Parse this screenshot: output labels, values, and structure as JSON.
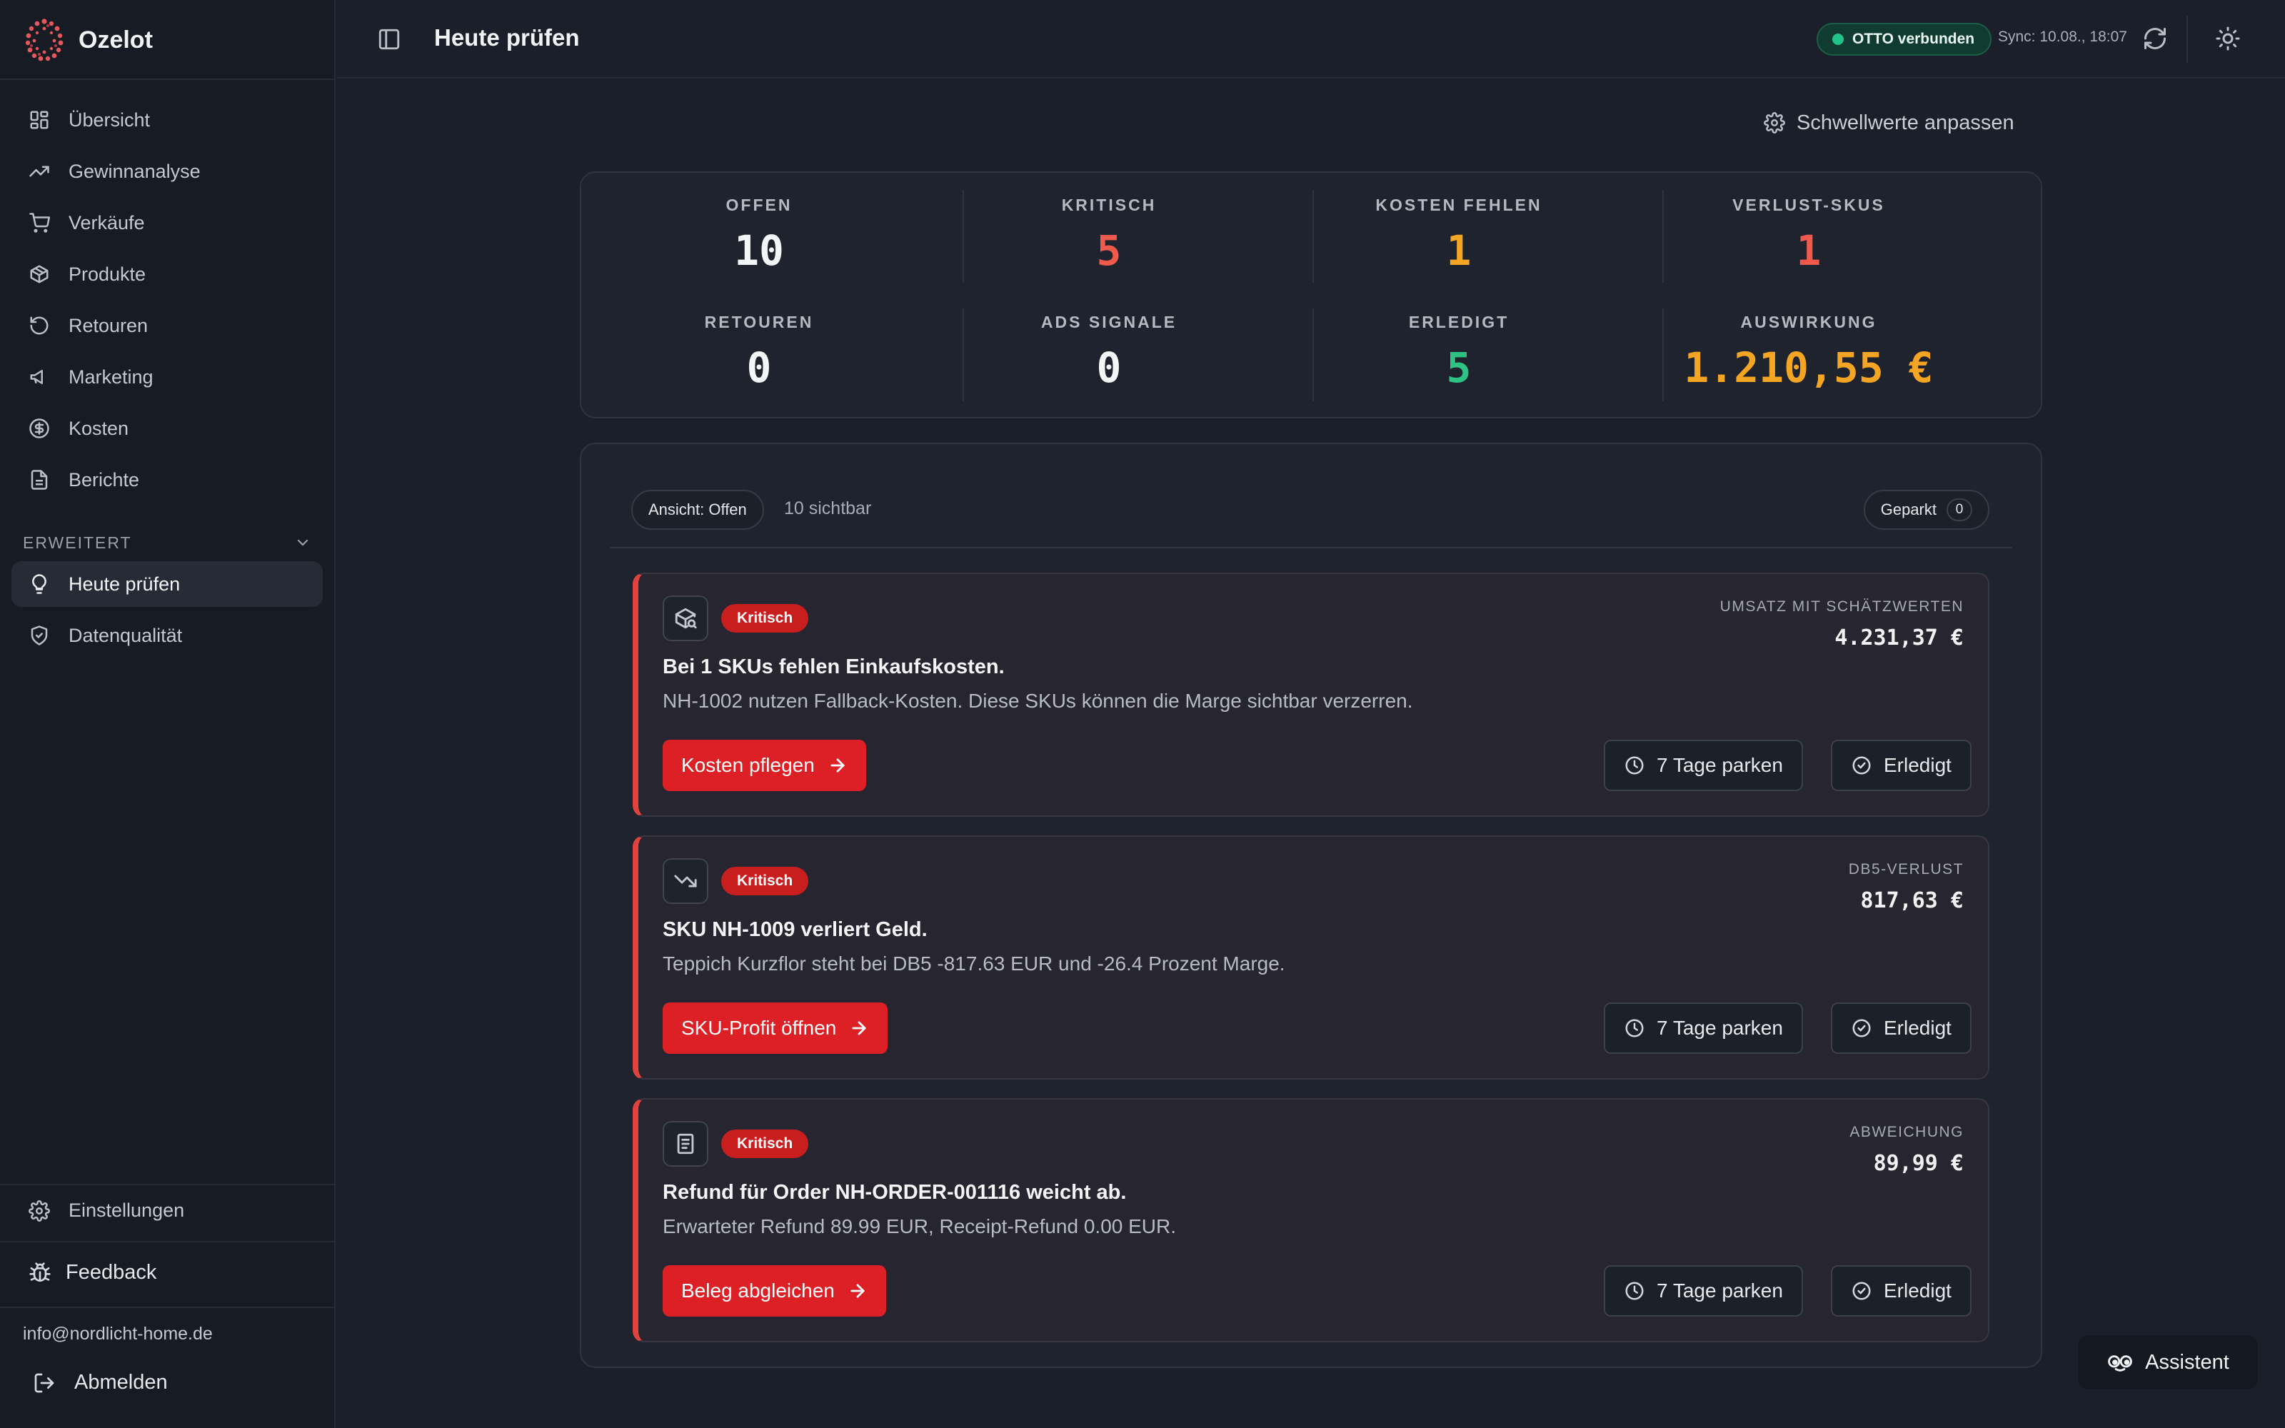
{
  "app": {
    "name": "Ozelot"
  },
  "sidebar": {
    "items": [
      {
        "label": "Übersicht",
        "icon": "dashboard-icon"
      },
      {
        "label": "Gewinnanalyse",
        "icon": "trending-up-icon"
      },
      {
        "label": "Verkäufe",
        "icon": "cart-icon"
      },
      {
        "label": "Produkte",
        "icon": "package-icon"
      },
      {
        "label": "Retouren",
        "icon": "undo-icon"
      },
      {
        "label": "Marketing",
        "icon": "megaphone-icon"
      },
      {
        "label": "Kosten",
        "icon": "dollar-circle-icon"
      },
      {
        "label": "Berichte",
        "icon": "file-text-icon"
      }
    ],
    "section_label": "ERWEITERT",
    "extended_items": [
      {
        "label": "Heute prüfen",
        "icon": "lightbulb-icon",
        "active": true
      },
      {
        "label": "Datenqualität",
        "icon": "shield-check-icon"
      }
    ],
    "settings_label": "Einstellungen",
    "feedback_label": "Feedback",
    "email": "info@nordlicht-home.de",
    "logout_label": "Abmelden"
  },
  "header": {
    "title": "Heute prüfen",
    "connection_status": "OTTO verbunden",
    "sync_text": "Sync: 10.08., 18:07"
  },
  "main": {
    "threshold_label": "Schwellwerte anpassen",
    "stats": [
      {
        "label": "OFFEN",
        "value": "10",
        "color": "#f4f5f7"
      },
      {
        "label": "KRITISCH",
        "value": "5",
        "color": "#ef5a4c"
      },
      {
        "label": "KOSTEN FEHLEN",
        "value": "1",
        "color": "#f5a524"
      },
      {
        "label": "VERLUST-SKUS",
        "value": "1",
        "color": "#ef5a4c"
      },
      {
        "label": "RETOUREN",
        "value": "0",
        "color": "#f4f5f7"
      },
      {
        "label": "ADS SIGNALE",
        "value": "0",
        "color": "#f4f5f7"
      },
      {
        "label": "ERLEDIGT",
        "value": "5",
        "color": "#2fc383"
      },
      {
        "label": "AUSWIRKUNG",
        "value": "1.210,55 €",
        "color": "#f5a524"
      }
    ],
    "view_chip": "Ansicht: Offen",
    "visible_count": "10 sichtbar",
    "parked_label": "Geparkt",
    "parked_count": "0",
    "cards": [
      {
        "icon": "package-search-icon",
        "badge": "Kritisch",
        "title": "Bei 1 SKUs fehlen Einkaufskosten.",
        "description": "NH-1002 nutzen Fallback-Kosten. Diese SKUs können die Marge sichtbar verzerren.",
        "metric_label": "UMSATZ MIT SCHÄTZWERTEN",
        "metric_value": "4.231,37 €",
        "action_label": "Kosten pflegen",
        "park_label": "7 Tage parken",
        "done_label": "Erledigt"
      },
      {
        "icon": "trending-down-icon",
        "badge": "Kritisch",
        "title": "SKU NH-1009 verliert Geld.",
        "description": "Teppich Kurzflor steht bei DB5 -817.63 EUR und -26.4 Prozent Marge.",
        "metric_label": "DB5-VERLUST",
        "metric_value": "817,63 €",
        "action_label": "SKU-Profit öffnen",
        "park_label": "7 Tage parken",
        "done_label": "Erledigt"
      },
      {
        "icon": "receipt-icon",
        "badge": "Kritisch",
        "title": "Refund für Order NH-ORDER-001116 weicht ab.",
        "description": "Erwarteter Refund 89.99 EUR, Receipt-Refund 0.00 EUR.",
        "metric_label": "ABWEICHUNG",
        "metric_value": "89,99 €",
        "action_label": "Beleg abgleichen",
        "park_label": "7 Tage parken",
        "done_label": "Erledigt"
      }
    ]
  },
  "assistant": {
    "label": "Assistent"
  },
  "colors": {
    "accent_red": "#dc2025",
    "success": "#22c38a",
    "warning": "#f5a524"
  }
}
